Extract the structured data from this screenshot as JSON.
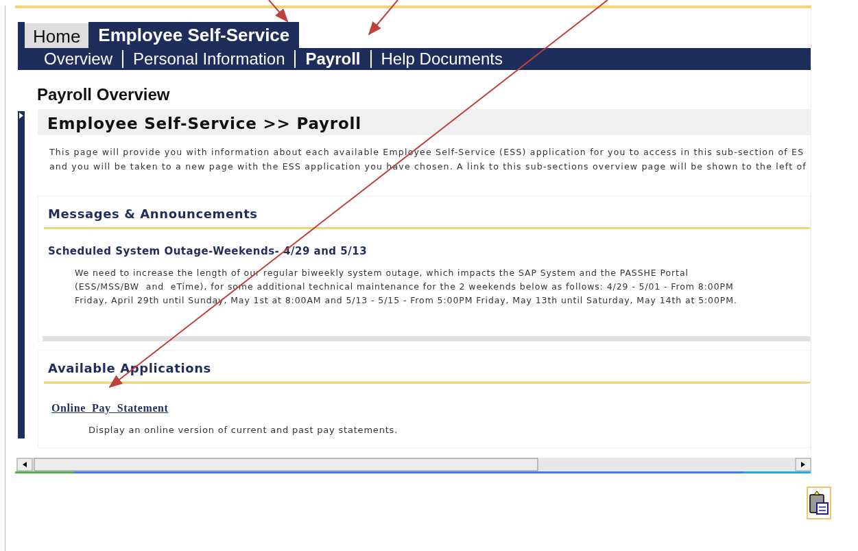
{
  "tabs": [
    {
      "label": "Home",
      "selected": false
    },
    {
      "label": "Employee Self-Service",
      "selected": true
    }
  ],
  "nav": [
    {
      "label": "Overview",
      "selected": false
    },
    {
      "label": "Personal Information",
      "selected": false
    },
    {
      "label": "Payroll",
      "selected": true
    },
    {
      "label": "Help Documents",
      "selected": false
    }
  ],
  "page_title": "Payroll Overview",
  "header": "Employee Self-Service >> Payroll",
  "intro_lines": [
    "This page will provide you with information about each available Employee Self-Service (ESS) application for you to access in this sub-section of ES",
    "and you will be taken to a new page with the ESS application you have chosen. A link to this sub-sections overview page will be shown to the left of"
  ],
  "messages": {
    "title": "Messages & Announcements",
    "items": [
      {
        "title": "Scheduled System Outage-Weekends- 4/29 and 5/13",
        "lines": [
          "We need to increase the length of our regular biweekly system outage, which impacts the SAP System and the PASSHE Portal",
          "(ESS/MSS/BW  and  eTime), for some additional technical maintenance for the 2 weekends below as follows: 4/29 - 5/01 - From 8:00PM",
          "Friday, April 29th until Sunday, May 1st at 8:00AM and 5/13 - 5/15 - From 5:00PM Friday, May 13th until Saturday, May 14th at 5:00PM."
        ]
      }
    ]
  },
  "applications": {
    "title": "Available Applications",
    "items": [
      {
        "link": "Online  Pay  Statement",
        "description": "Display an online version of current and past pay statements."
      }
    ]
  }
}
